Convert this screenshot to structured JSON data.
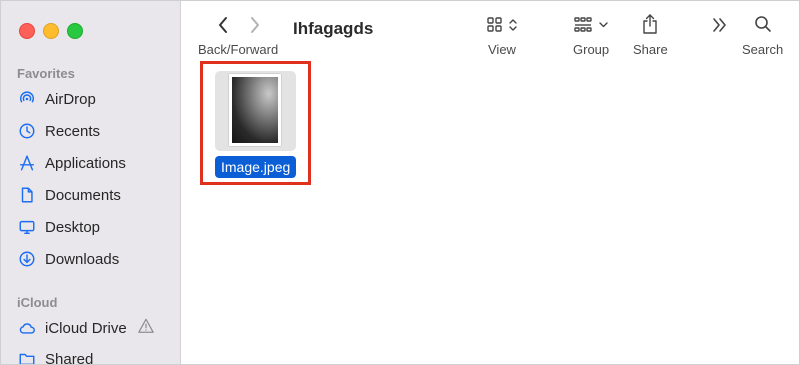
{
  "window": {
    "title": "Ihfagagds"
  },
  "toolbar": {
    "back_forward_label": "Back/Forward",
    "view_label": "View",
    "group_label": "Group",
    "share_label": "Share",
    "search_label": "Search"
  },
  "sidebar": {
    "favorites_title": "Favorites",
    "favorites": [
      {
        "label": "AirDrop",
        "icon": "airdrop-icon"
      },
      {
        "label": "Recents",
        "icon": "clock-icon"
      },
      {
        "label": "Applications",
        "icon": "applications-icon"
      },
      {
        "label": "Documents",
        "icon": "document-icon"
      },
      {
        "label": "Desktop",
        "icon": "desktop-icon"
      },
      {
        "label": "Downloads",
        "icon": "download-icon"
      }
    ],
    "icloud_title": "iCloud",
    "icloud": [
      {
        "label": "iCloud Drive",
        "icon": "cloud-icon",
        "status_icon": "warning-icon"
      },
      {
        "label": "Shared",
        "icon": "shared-folder-icon"
      }
    ]
  },
  "files": [
    {
      "name": "Image.jpeg",
      "selected": true
    }
  ],
  "colors": {
    "accent": "#0a5fd6",
    "sidebar_icon": "#1c6ef2",
    "highlight_box": "#e0301e"
  }
}
